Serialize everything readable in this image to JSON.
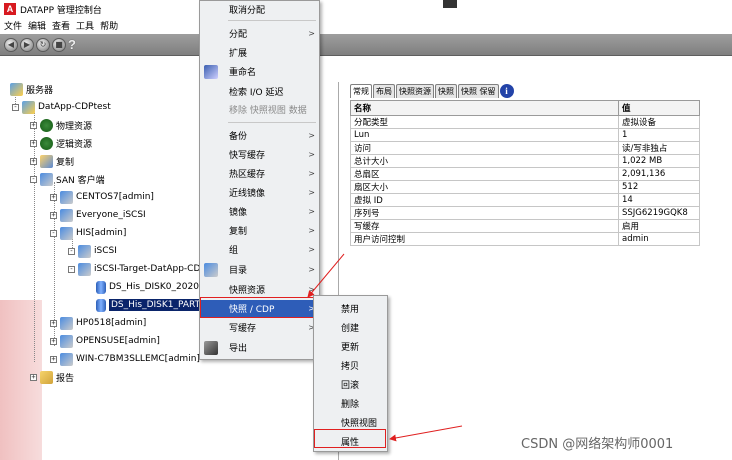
{
  "window": {
    "brand_letter": "A",
    "title": "DATAPP 管理控制台"
  },
  "menubar": [
    "文件",
    "编辑",
    "查看",
    "工具",
    "帮助"
  ],
  "toolbar": {
    "help_glyph": "?"
  },
  "tree": [
    {
      "label": "服务器",
      "level": 0,
      "icon": "server-icon"
    },
    {
      "label": "DatApp-CDPtest",
      "level": 1,
      "icon": "server-icon"
    },
    {
      "label": "物理资源",
      "level": 2,
      "icon": "globe-icon"
    },
    {
      "label": "逻辑资源",
      "level": 2,
      "icon": "globe-icon"
    },
    {
      "label": "复制",
      "level": 2,
      "icon": "copy-icon"
    },
    {
      "label": "SAN 客户端",
      "level": 2,
      "icon": "client-icon"
    },
    {
      "label": "CENTOS7[admin]",
      "level": 3,
      "icon": "client-icon"
    },
    {
      "label": "Everyone_iSCSI",
      "level": 3,
      "icon": "client-icon"
    },
    {
      "label": "HIS[admin]",
      "level": 3,
      "icon": "client-icon"
    },
    {
      "label": "iSCSI",
      "level": 4,
      "icon": "client-icon"
    },
    {
      "label": "iSCSI-Target-DatApp-CDP",
      "level": 5,
      "icon": "client-icon"
    },
    {
      "label": "DS_His_DISK0_2020",
      "level": 6,
      "icon": "disk-icon"
    },
    {
      "label": "DS_His_DISK1_PART",
      "level": 6,
      "icon": "disk-icon",
      "selected": true
    },
    {
      "label": "HP0518[admin]",
      "level": 3,
      "icon": "client-icon"
    },
    {
      "label": "OPENSUSE[admin]",
      "level": 3,
      "icon": "client-icon"
    },
    {
      "label": "WIN-C7BM3SLLEMC[admin]",
      "level": 3,
      "icon": "client-icon"
    },
    {
      "label": "报告",
      "level": 2,
      "icon": "report-icon"
    }
  ],
  "context_menu": [
    {
      "label": "取消分配"
    },
    {
      "label": "分配",
      "submenu": true
    },
    {
      "label": "扩展"
    },
    {
      "label": "重命名"
    },
    {
      "label": "检索 I/O 延迟"
    },
    {
      "label": "移除 快照视图 数据",
      "disabled": true
    },
    {
      "label": "备份",
      "submenu": true
    },
    {
      "label": "快写缓存",
      "submenu": true
    },
    {
      "label": "热区缓存",
      "submenu": true
    },
    {
      "label": "近线镜像",
      "submenu": true
    },
    {
      "label": "镜像",
      "submenu": true
    },
    {
      "label": "复制",
      "submenu": true
    },
    {
      "label": "组",
      "submenu": true
    },
    {
      "label": "目录",
      "submenu": true
    },
    {
      "label": "快照资源",
      "submenu": true
    },
    {
      "label": "快照 / CDP",
      "submenu": true,
      "active": true
    },
    {
      "label": "写缓存",
      "submenu": true
    },
    {
      "label": "导出"
    }
  ],
  "submenu": [
    "禁用",
    "创建",
    "更新",
    "拷贝",
    "回滚",
    "删除",
    "快照视图",
    "属性"
  ],
  "tabs": [
    "常规",
    "布局",
    "快照资源",
    "快照",
    "快照 保留"
  ],
  "properties": {
    "header": [
      "名称",
      "值"
    ],
    "rows": [
      [
        "分配类型",
        "虚拟设备"
      ],
      [
        "Lun",
        "1"
      ],
      [
        "访问",
        "读/写非独占"
      ],
      [
        "总计大小",
        "1,022 MB"
      ],
      [
        "总扇区",
        "2,091,136"
      ],
      [
        "扇区大小",
        "512"
      ],
      [
        "虚拟 ID",
        "14"
      ],
      [
        "序列号",
        "SSJG6219GQK8"
      ],
      [
        "写缓存",
        "启用"
      ],
      [
        "用户访问控制",
        "admin"
      ]
    ]
  },
  "watermark": "CSDN @网络架构师0001",
  "colors": {
    "selection": "#0a246a",
    "menu_active": "#2e5db8",
    "annotation": "#e02020",
    "brand": "#d71920"
  }
}
